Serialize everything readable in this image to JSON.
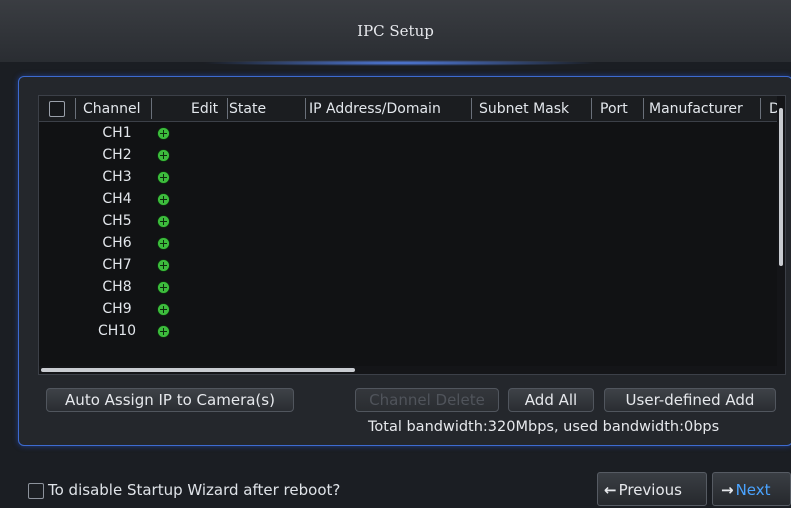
{
  "window": {
    "title": "IPC Setup"
  },
  "table": {
    "columns": [
      "Channel",
      "Edit",
      "State",
      "IP Address/Domain",
      "Subnet Mask",
      "Port",
      "Manufacturer",
      "D"
    ],
    "rows": [
      {
        "channel": "CH1"
      },
      {
        "channel": "CH2"
      },
      {
        "channel": "CH3"
      },
      {
        "channel": "CH4"
      },
      {
        "channel": "CH5"
      },
      {
        "channel": "CH6"
      },
      {
        "channel": "CH7"
      },
      {
        "channel": "CH8"
      },
      {
        "channel": "CH9"
      },
      {
        "channel": "CH10"
      }
    ]
  },
  "actions": {
    "auto_assign": "Auto Assign IP to Camera(s)",
    "channel_delete": "Channel Delete",
    "add_all": "Add All",
    "user_defined_add": "User-defined Add"
  },
  "bandwidth_text": "Total bandwidth:320Mbps, used bandwidth:0bps",
  "footer": {
    "disable_wizard_label": "To disable Startup Wizard after reboot?",
    "previous_label": "Previous",
    "next_label": "Next"
  },
  "colors": {
    "accent": "#3d6bd0",
    "add_icon": "#3dbb3d",
    "next": "#4aa3ff"
  }
}
